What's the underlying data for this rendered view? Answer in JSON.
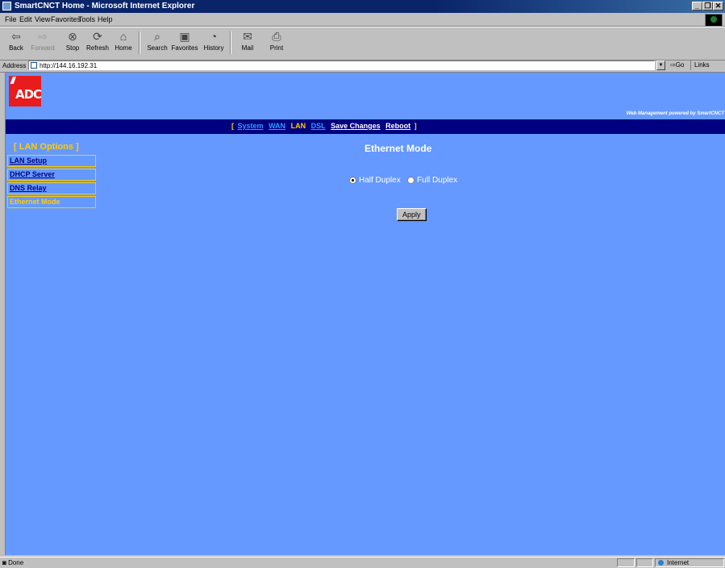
{
  "window": {
    "title": "SmartCNCT Home - Microsoft Internet Explorer"
  },
  "menu": [
    "File",
    "Edit",
    "View",
    "Favorites",
    "Tools",
    "Help"
  ],
  "toolbar": [
    {
      "label": "Back",
      "icon": "back-arrow"
    },
    {
      "label": "Forward",
      "icon": "forward-arrow"
    },
    {
      "label": "Stop",
      "icon": "stop"
    },
    {
      "label": "Refresh",
      "icon": "refresh"
    },
    {
      "label": "Home",
      "icon": "home"
    },
    {
      "label": "Search",
      "icon": "search"
    },
    {
      "label": "Favorites",
      "icon": "favorites"
    },
    {
      "label": "History",
      "icon": "history"
    },
    {
      "label": "Mail",
      "icon": "mail"
    },
    {
      "label": "Print",
      "icon": "print"
    }
  ],
  "address": {
    "label": "Address",
    "url": "http://144.16.192.31",
    "go": "Go",
    "links": "Links"
  },
  "page": {
    "logo": "ADC",
    "powered_by": "Web Management powered by SmartCNCT",
    "nav": {
      "open": "[",
      "close": "]",
      "items": [
        "System",
        "WAN",
        "LAN",
        "DSL",
        "Save Changes",
        "Reboot"
      ]
    },
    "sidebar": {
      "title": "[ LAN Options ]",
      "items": [
        "LAN Setup",
        "DHCP Server",
        "DNS Relay",
        "Ethernet Mode"
      ]
    },
    "heading": "Ethernet Mode",
    "radio_options": [
      "Half Duplex",
      "Full Duplex"
    ],
    "selected_option": "Half Duplex",
    "apply_label": "Apply"
  },
  "status": {
    "text": "Done",
    "zone": "Internet"
  }
}
